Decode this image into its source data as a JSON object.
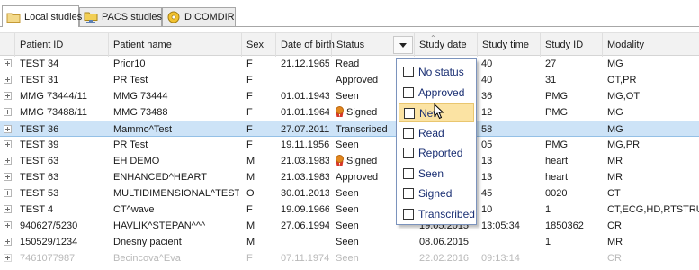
{
  "tabs": [
    {
      "label": "Local studies",
      "icon": "folder-icon",
      "active": true
    },
    {
      "label": "PACS studies",
      "icon": "network-folder-icon",
      "active": false
    },
    {
      "label": "DICOMDIR",
      "icon": "disc-icon",
      "active": false
    }
  ],
  "columns": [
    "Patient ID",
    "Patient name",
    "Sex",
    "Date of birth",
    "Status",
    "Study date",
    "Study time",
    "Study ID",
    "Modality"
  ],
  "rows": [
    {
      "patient_id": "TEST 34",
      "patient_name": "Prior10",
      "sex": "F",
      "dob": "21.12.1965",
      "status": "Read",
      "study_date": "",
      "study_time": "40",
      "study_id": "27",
      "modality": "MG"
    },
    {
      "patient_id": "TEST 31",
      "patient_name": "PR Test",
      "sex": "F",
      "dob": "",
      "status": "Approved",
      "study_date": "",
      "study_time": "40",
      "study_id": "31",
      "modality": "OT,PR"
    },
    {
      "patient_id": "MMG 73444/11",
      "patient_name": "MMG 73444",
      "sex": "F",
      "dob": "01.01.1943",
      "status": "Seen",
      "study_date": "",
      "study_time": "36",
      "study_id": "PMG",
      "modality": "MG,OT"
    },
    {
      "patient_id": "MMG 73488/11",
      "patient_name": "MMG 73488",
      "sex": "F",
      "dob": "01.01.1964",
      "status": "Signed",
      "study_date": "",
      "study_time": "12",
      "study_id": "PMG",
      "modality": "MG"
    },
    {
      "patient_id": "TEST 36",
      "patient_name": "Mammo^Test",
      "sex": "F",
      "dob": "27.07.2011",
      "status": "Transcribed",
      "study_date": "",
      "study_time": "58",
      "study_id": "",
      "modality": "MG"
    },
    {
      "patient_id": "TEST 39",
      "patient_name": "PR Test",
      "sex": "F",
      "dob": "19.11.1956",
      "status": "Seen",
      "study_date": "",
      "study_time": "05",
      "study_id": "PMG",
      "modality": "MG,PR"
    },
    {
      "patient_id": "TEST 63",
      "patient_name": "EH DEMO",
      "sex": "M",
      "dob": "21.03.1983",
      "status": "Signed",
      "study_date": "",
      "study_time": "13",
      "study_id": "heart",
      "modality": "MR"
    },
    {
      "patient_id": "TEST 63",
      "patient_name": "ENHANCED^HEART",
      "sex": "M",
      "dob": "21.03.1983",
      "status": "Approved",
      "study_date": "",
      "study_time": "13",
      "study_id": "heart",
      "modality": "MR"
    },
    {
      "patient_id": "TEST 53",
      "patient_name": "MULTIDIMENSIONAL^TEST",
      "sex": "O",
      "dob": "30.01.2013",
      "status": "Seen",
      "study_date": "",
      "study_time": "45",
      "study_id": "0020",
      "modality": "CT"
    },
    {
      "patient_id": "TEST 4",
      "patient_name": "CT^wave",
      "sex": "F",
      "dob": "19.09.1966",
      "status": "Seen",
      "study_date": "",
      "study_time": "10",
      "study_id": "1",
      "modality": "CT,ECG,HD,RTSTRUC"
    },
    {
      "patient_id": "940627/5230",
      "patient_name": "HAVLIK^STEPAN^^^",
      "sex": "M",
      "dob": "27.06.1994",
      "status": "Seen",
      "study_date": "19.05.2015",
      "study_time": "13:05:34",
      "study_id": "1850362",
      "modality": "CR"
    },
    {
      "patient_id": "150529/1234",
      "patient_name": "Dnesny pacient",
      "sex": "M",
      "dob": "",
      "status": "Seen",
      "study_date": "08.06.2015",
      "study_time": "",
      "study_id": "1",
      "modality": "MR"
    },
    {
      "patient_id": "7461077987",
      "patient_name": "Becincova^Eva",
      "sex": "F",
      "dob": "07.11.1974",
      "status": "Seen",
      "study_date": "22.02.2016",
      "study_time": "09:13:14",
      "study_id": "",
      "modality": "CR"
    }
  ],
  "selected_row": 4,
  "status_filter": {
    "options": [
      "No status",
      "Approved",
      "New",
      "Read",
      "Reported",
      "Seen",
      "Signed",
      "Transcribed"
    ],
    "hovered": "New",
    "checked": []
  },
  "colors": {
    "selection": "#cde3f7",
    "hover": "#fbe3a3",
    "option_text": "#1a2f73",
    "signed_icon": "#e2871f"
  }
}
